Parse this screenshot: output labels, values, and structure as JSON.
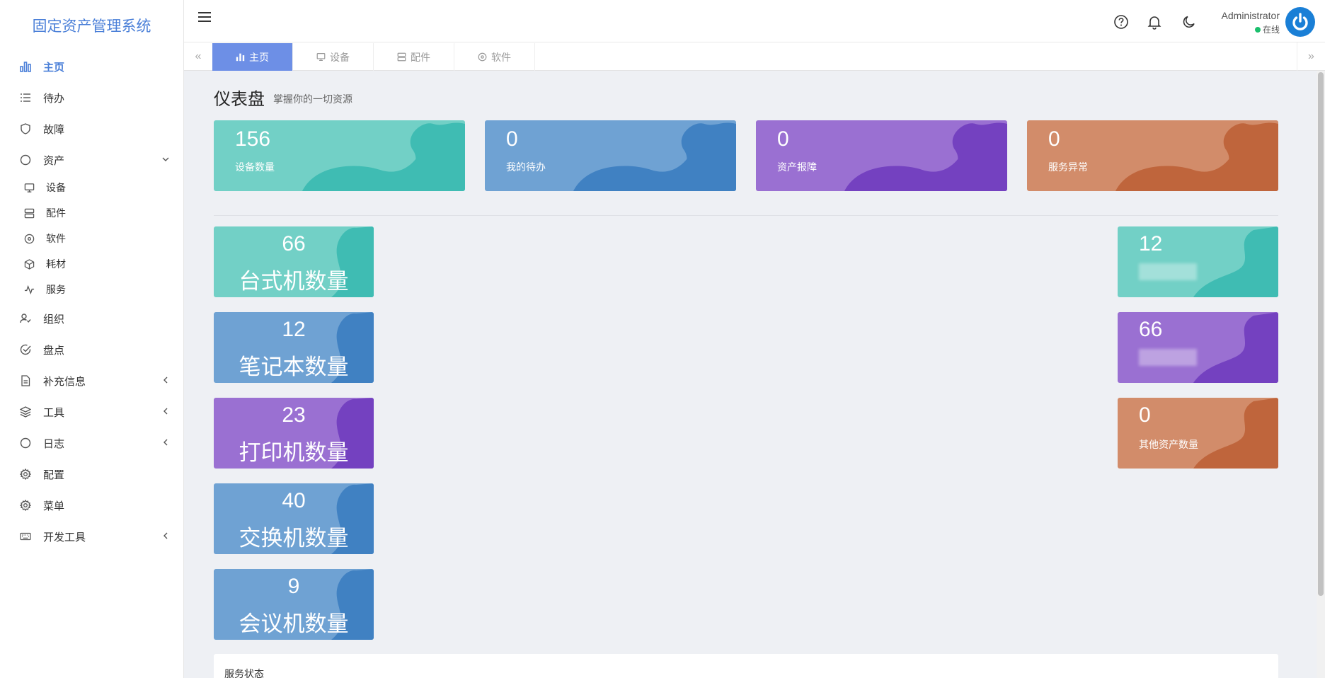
{
  "app": {
    "title": "固定资产管理系统"
  },
  "sidebar": {
    "items": [
      {
        "label": "主页",
        "icon": "bar-chart-icon",
        "active": true
      },
      {
        "label": "待办",
        "icon": "list-icon"
      },
      {
        "label": "故障",
        "icon": "shield-icon"
      },
      {
        "label": "资产",
        "icon": "circle-icon",
        "expanded": true
      },
      {
        "label": "组织",
        "icon": "user-check-icon"
      },
      {
        "label": "盘点",
        "icon": "check-circle-icon"
      },
      {
        "label": "补充信息",
        "icon": "file-icon",
        "collapsible": true
      },
      {
        "label": "工具",
        "icon": "layers-icon",
        "collapsible": true
      },
      {
        "label": "日志",
        "icon": "circle-icon",
        "collapsible": true
      },
      {
        "label": "配置",
        "icon": "gear-icon"
      },
      {
        "label": "菜单",
        "icon": "gear-icon"
      },
      {
        "label": "开发工具",
        "icon": "keyboard-icon",
        "collapsible": true
      }
    ],
    "asset_sub": [
      {
        "label": "设备",
        "icon": "monitor-icon"
      },
      {
        "label": "配件",
        "icon": "server-icon"
      },
      {
        "label": "软件",
        "icon": "disc-icon"
      },
      {
        "label": "耗材",
        "icon": "box-icon"
      },
      {
        "label": "服务",
        "icon": "activity-icon"
      }
    ]
  },
  "header": {
    "icons": [
      "help-icon",
      "bell-icon",
      "moon-icon"
    ],
    "user": {
      "name": "Administrator",
      "status": "在线"
    }
  },
  "tabs": [
    {
      "label": "主页",
      "icon": "bar-chart-icon",
      "active": true
    },
    {
      "label": "设备",
      "icon": "monitor-icon"
    },
    {
      "label": "配件",
      "icon": "server-icon"
    },
    {
      "label": "软件",
      "icon": "disc-icon"
    }
  ],
  "dashboard": {
    "title": "仪表盘",
    "subtitle": "掌握你的一切资源",
    "stats": [
      {
        "value": "156",
        "label": "设备数量",
        "color": "#72d0c6"
      },
      {
        "value": "0",
        "label": "我的待办",
        "color": "#6fa2d3"
      },
      {
        "value": "0",
        "label": "资产报障",
        "color": "#9a70d2"
      },
      {
        "value": "0",
        "label": "服务异常",
        "color": "#d28c6a"
      }
    ],
    "left_cards": [
      {
        "value": "66",
        "label": "台式机数量",
        "color": "#72d0c6"
      },
      {
        "value": "12",
        "label": "笔记本数量",
        "color": "#6fa2d3"
      },
      {
        "value": "23",
        "label": "打印机数量",
        "color": "#9a70d2"
      },
      {
        "value": "40",
        "label": "交换机数量",
        "color": "#6fa2d3"
      },
      {
        "value": "9",
        "label": "会议机数量",
        "color": "#6fa2d3"
      }
    ],
    "right_cards": [
      {
        "value": "12",
        "label": "",
        "color": "#72d0c6"
      },
      {
        "value": "66",
        "label": "",
        "color": "#9a70d2"
      },
      {
        "value": "0",
        "label": "其他资产数量",
        "color": "#d28c6a"
      }
    ],
    "panel_title": "服务状态"
  }
}
